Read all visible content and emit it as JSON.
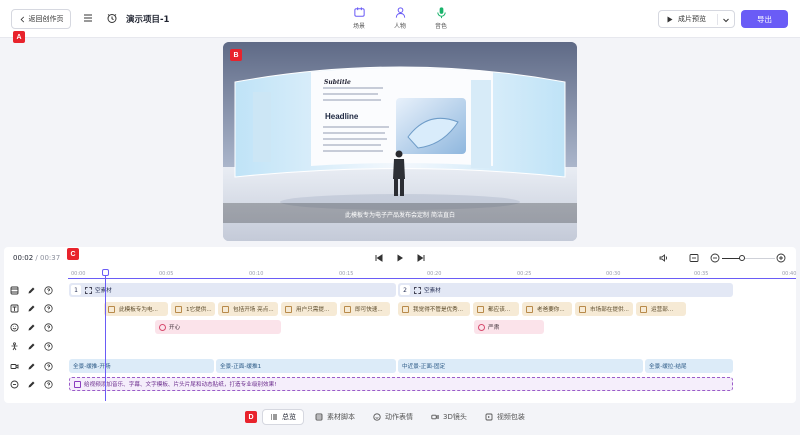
{
  "header": {
    "back_label": "返回创作页",
    "project_title": "演示项目-1",
    "nav": [
      {
        "label": "场景",
        "icon": "scene-icon"
      },
      {
        "label": "人物",
        "icon": "person-icon"
      },
      {
        "label": "音色",
        "icon": "microphone-icon"
      }
    ],
    "preview_label": "成片预览",
    "export_label": "导出"
  },
  "badges": {
    "a": "A",
    "b": "B",
    "c": "C",
    "d": "D"
  },
  "preview": {
    "subtitle": "Subtitle",
    "headline": "Headline",
    "caption": "此模板专为电子产品发布会定制 简洁直白"
  },
  "timeline": {
    "current_time": "00:02",
    "separator": " / ",
    "total_time": "00:37",
    "ticks": [
      "00:00",
      "00:05",
      "00:10",
      "00:15",
      "00:20",
      "00:25",
      "00:30",
      "00:35",
      "00:40"
    ],
    "scene_clips": [
      {
        "num": "1",
        "label": "空素材"
      },
      {
        "num": "2",
        "label": "空素材"
      }
    ],
    "script_clips": [
      "此模板专为电...",
      "1它提供...",
      "包括开场 亮点...",
      "用户只需提...",
      "即可快速...",
      "我觉得不管是优秀...",
      "都应该...",
      "老爸要你...",
      "市场部在提供...",
      "运营部..."
    ],
    "emotion_clips": [
      "开心",
      "严肃"
    ],
    "camera_clips": [
      "全景-缓推-开场",
      "全景-正面-缓推1",
      "中近景-正面-固定",
      "全景-缓拉-结尾"
    ],
    "package_hint": "给视频添加音乐、字幕、文字模板、片头片尾和动态贴纸，打造专业级别效果!"
  },
  "tabs": [
    {
      "label": "总览",
      "active": true
    },
    {
      "label": "素材脚本",
      "active": false
    },
    {
      "label": "动作表情",
      "active": false
    },
    {
      "label": "3D镜头",
      "active": false
    },
    {
      "label": "视频包装",
      "active": false
    }
  ],
  "colors": {
    "accent": "#6a5cf6",
    "badge": "#e8232c"
  }
}
